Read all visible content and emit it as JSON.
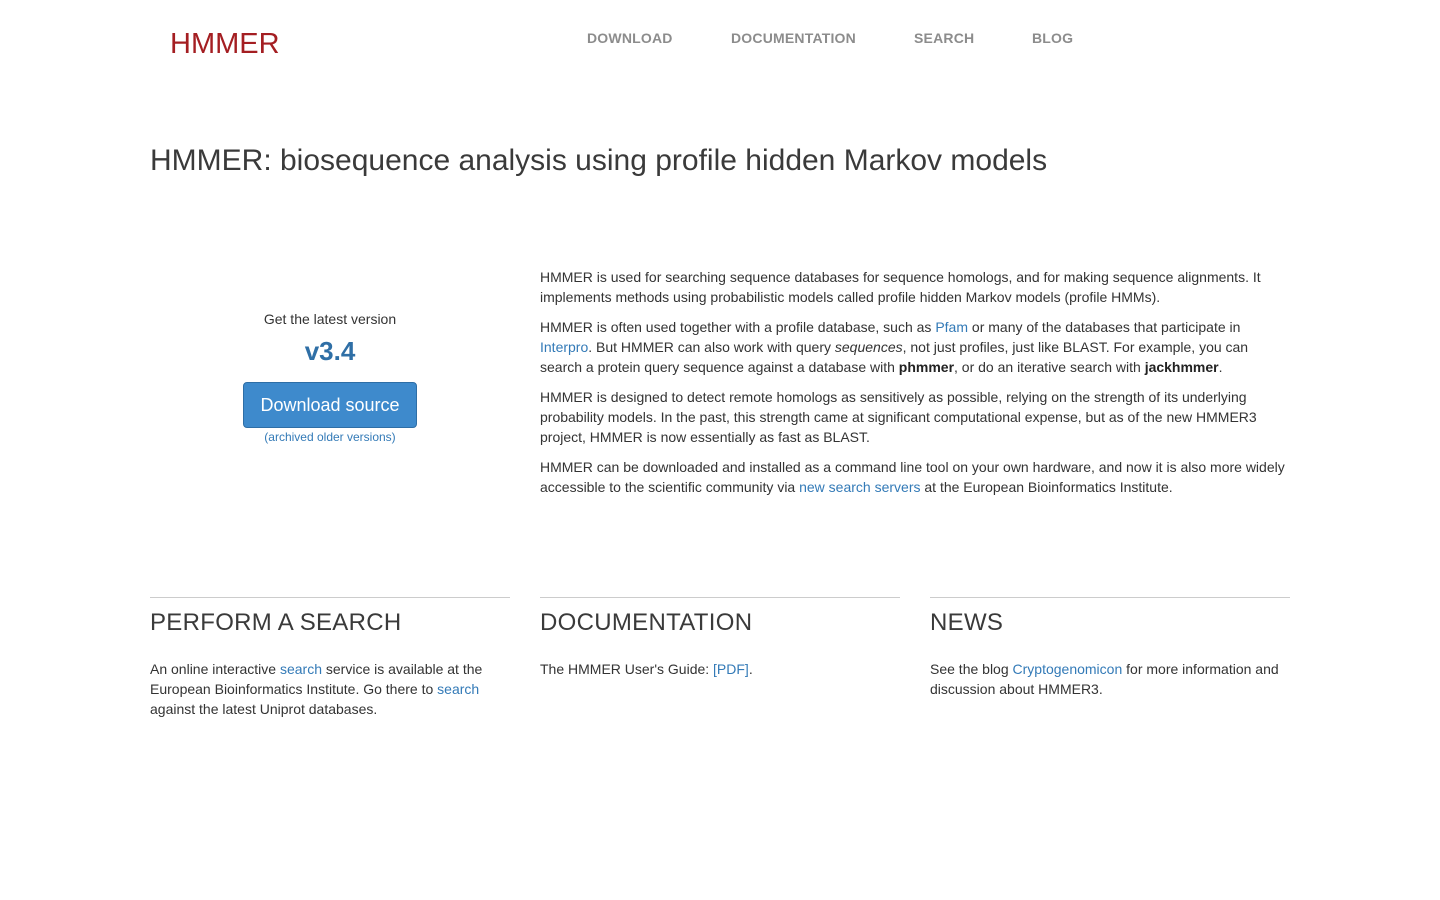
{
  "header": {
    "brand": "HMMER",
    "nav": {
      "download": "DOWNLOAD",
      "documentation": "DOCUMENTATION",
      "search": "SEARCH",
      "blog": "BLOG"
    }
  },
  "title": "HMMER: biosequence analysis using profile hidden Markov models",
  "download": {
    "latest_label": "Get the latest version",
    "version": "v3.4",
    "button_label": "Download source",
    "archived_link": "(archived older versions)"
  },
  "intro": {
    "p1": "HMMER is used for searching sequence databases for sequence homologs, and for making sequence alignments. It implements methods using probabilistic models called profile hidden Markov models (profile HMMs).",
    "p2": {
      "t1": "HMMER is often used together with a profile database, such as ",
      "link_pfam": "Pfam",
      "t2": " or many of the databases that participate in ",
      "link_interpro": "Interpro",
      "t3": ". But HMMER can also work with query ",
      "em": "sequences",
      "t4": ", not just profiles, just like BLAST. For example, you can search a protein query sequence against a database with ",
      "b1": "phmmer",
      "t5": ", or do an iterative search with ",
      "b2": "jackhmmer",
      "t6": "."
    },
    "p3": "HMMER is designed to detect remote homologs as sensitively as possible, relying on the strength of its underlying probability models. In the past, this strength came at significant computational expense, but as of the new HMMER3 project, HMMER is now essentially as fast as BLAST.",
    "p4": {
      "t1": "HMMER can be downloaded and installed as a command line tool on your own hardware, and now it is also more widely accessible to the scientific community via ",
      "link": "new search servers",
      "t2": " at the European Bioinformatics Institute."
    }
  },
  "search_section": {
    "heading": "PERFORM A SEARCH",
    "t1": "An online interactive ",
    "link1": "search",
    "t2": " service is available at the European Bioinformatics Institute. Go there to ",
    "link2": "search",
    "t3": " against the latest Uniprot databases."
  },
  "docs_section": {
    "heading": "DOCUMENTATION",
    "t1": "The HMMER User's Guide: ",
    "link": "[PDF]",
    "t2": "."
  },
  "news_section": {
    "heading": "NEWS",
    "t1": "See the blog ",
    "link": "Cryptogenomicon",
    "t2": " for more information and discussion about HMMER3."
  }
}
